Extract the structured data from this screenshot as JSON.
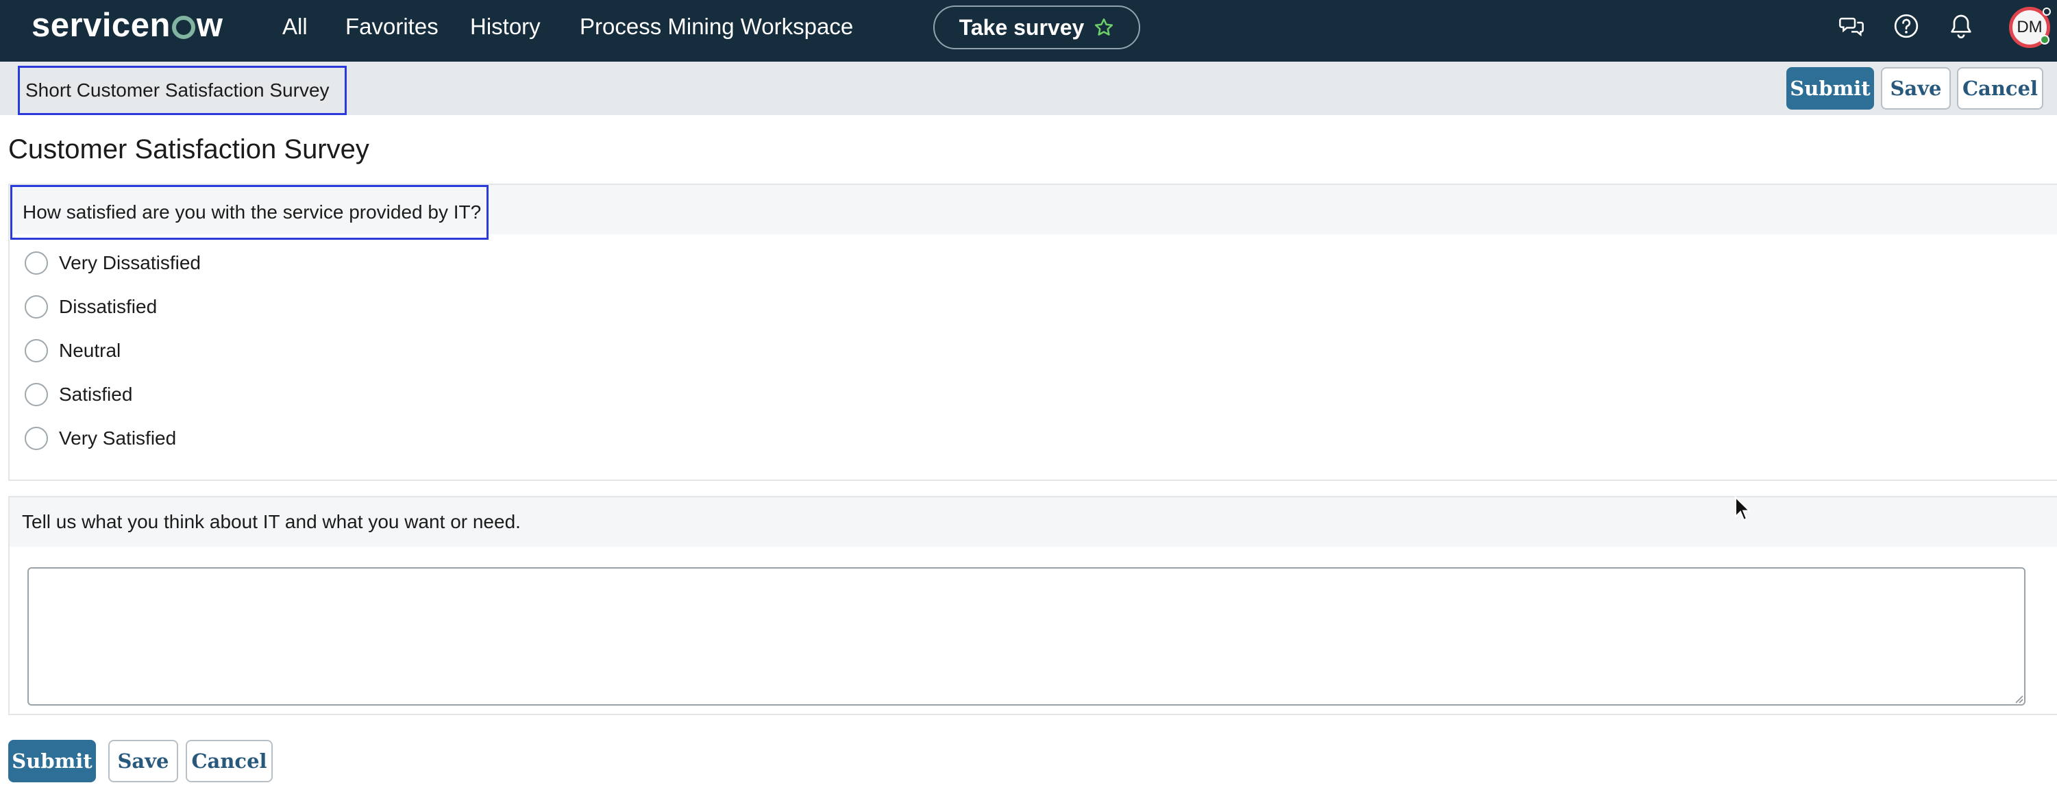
{
  "nav": {
    "logo_text": "servicenow",
    "logo_pre": "servicen",
    "logo_post": "w",
    "items": [
      {
        "label": "All"
      },
      {
        "label": "Favorites"
      },
      {
        "label": "History"
      },
      {
        "label": "Process Mining Workspace"
      }
    ],
    "survey_button": "Take survey",
    "survey_icon": "star-outline-icon",
    "icons": [
      "chat-icon",
      "help-icon",
      "bell-icon"
    ],
    "avatar_initials": "DM"
  },
  "form_header": {
    "title": "Short Customer Satisfaction Survey",
    "submit_label": "Submit",
    "save_label": "Save",
    "cancel_label": "Cancel"
  },
  "page": {
    "title": "Customer Satisfaction Survey"
  },
  "question1": {
    "label": "How satisfied are you with the service provided by IT?",
    "options": [
      {
        "label": "Very Dissatisfied",
        "selected": false
      },
      {
        "label": "Dissatisfied",
        "selected": false
      },
      {
        "label": "Neutral",
        "selected": false
      },
      {
        "label": "Satisfied",
        "selected": false
      },
      {
        "label": "Very Satisfied",
        "selected": false
      }
    ]
  },
  "question2": {
    "label": "Tell us what you think about IT and what you want or need.",
    "value": ""
  },
  "footer": {
    "submit_label": "Submit",
    "save_label": "Save",
    "cancel_label": "Cancel"
  },
  "colors": {
    "nav_bg": "#162d3d",
    "primary_button": "#2e6f97",
    "highlight_border": "#2b3bdb",
    "avatar_ring": "#e0444c"
  }
}
